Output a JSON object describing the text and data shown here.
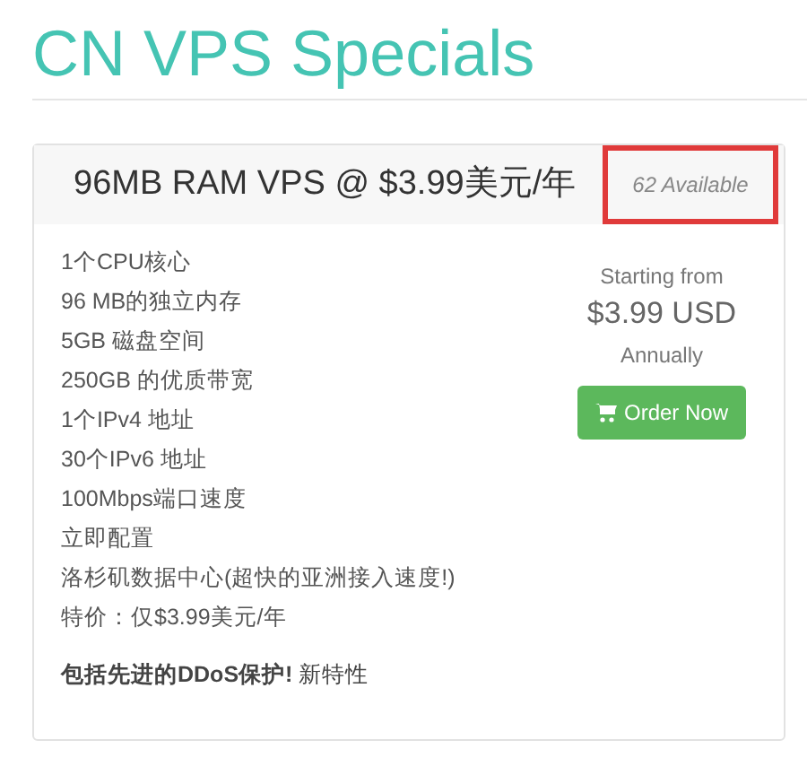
{
  "page_title": "CN VPS Specials",
  "product": {
    "name": "96MB RAM VPS @ $3.99美元/年",
    "availability": "62 Available",
    "availability_highlighted": true,
    "features": [
      "1个CPU核心",
      "96 MB的独立内存",
      "5GB 磁盘空间",
      "250GB 的优质带宽",
      "1个IPv4 地址",
      "30个IPv6 地址",
      "100Mbps端口速度",
      "立即配置",
      "洛杉矶数据中心(超快的亚洲接入速度!)",
      "特价：仅$3.99美元/年"
    ],
    "note": "**包括先进的DDoS保护!** 新特性",
    "pricing": {
      "prefix": "Starting from",
      "price": "$3.99 USD",
      "cycle": "Annually"
    },
    "order_button": "Order Now"
  }
}
